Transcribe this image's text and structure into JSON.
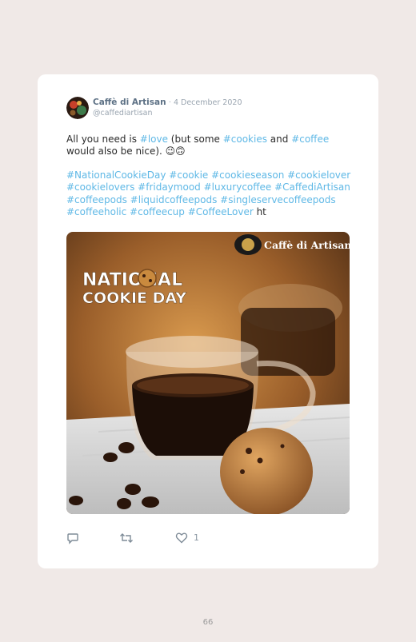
{
  "post": {
    "author_name": "Caffè di Artisan",
    "date": "· 4 December 2020",
    "handle": "@caffediartisan",
    "text_parts": [
      "All you need is ",
      "#love",
      " (but some ",
      "#cookies",
      " and ",
      "#coffee",
      " would also be nice). 😉🙃"
    ],
    "hashtags": "#NationalCookieDay #cookie #cookieseason #cookielover #cookielovers #fridaymood #luxurycoffee #CaffediArtisan #coffeepods #liquidcoffeepods #singleservecoffeepods #coffeeholic #coffeecup #CoffeeLover",
    "trailing": " ht",
    "image": {
      "brand_watermark": "Caffè di Artisan",
      "headline_line1": "NATIONAL",
      "headline_line2": "COOKIE DAY"
    }
  },
  "actions": {
    "reply_icon": "reply-icon",
    "retweet_icon": "retweet-icon",
    "like_icon": "heart-icon",
    "like_count": "1"
  },
  "page": {
    "number": "66"
  },
  "colors": {
    "background": "#f0e9e7",
    "link": "#5fb8e6",
    "name": "#5d7185"
  }
}
